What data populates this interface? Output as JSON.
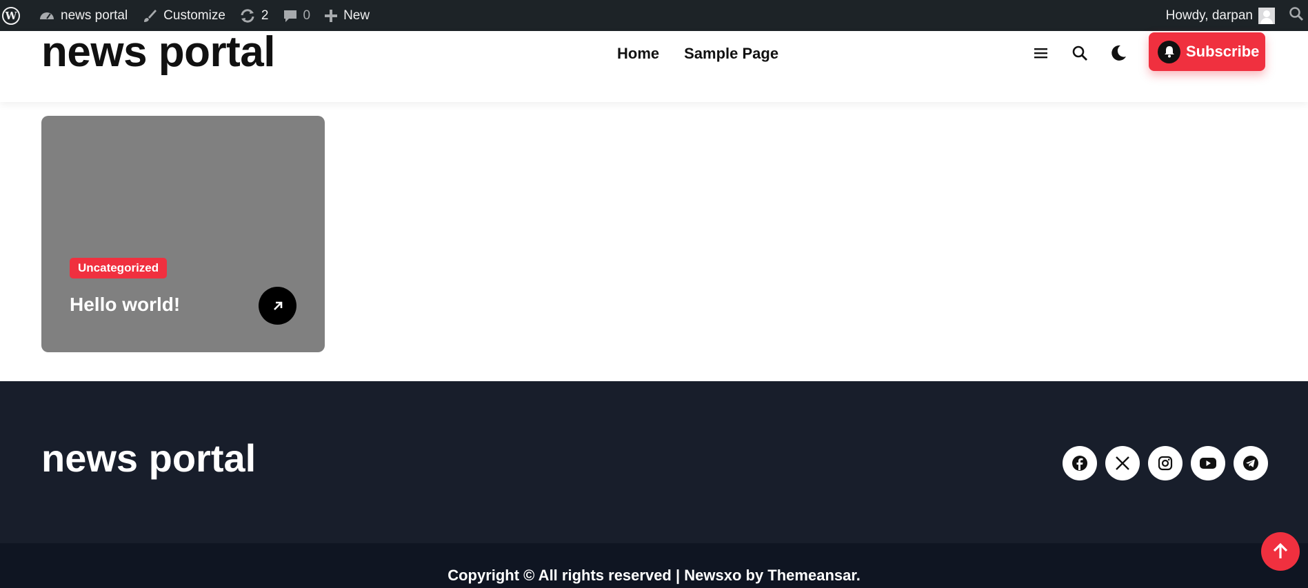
{
  "admin_bar": {
    "site_name": "news portal",
    "customize": "Customize",
    "updates_count": "2",
    "comments_count": "0",
    "new_label": "New",
    "howdy": "Howdy, darpan"
  },
  "header": {
    "site_title": "news portal",
    "nav": [
      "Home",
      "Sample Page"
    ],
    "subscribe_label": "Subscribe"
  },
  "post": {
    "category": "Uncategorized",
    "title": "Hello world!"
  },
  "footer": {
    "site_title": "news portal",
    "socials": [
      "facebook-icon",
      "x-icon",
      "instagram-icon",
      "youtube-icon",
      "telegram-icon"
    ],
    "copyright": "Copyright © All rights reserved | Newsxo by Themeansar."
  },
  "colors": {
    "accent": "#f0303f",
    "admin_bar": "#1d2327",
    "footer": "#181e2b",
    "footer_bottom": "#0f1522",
    "card": "#808080"
  }
}
